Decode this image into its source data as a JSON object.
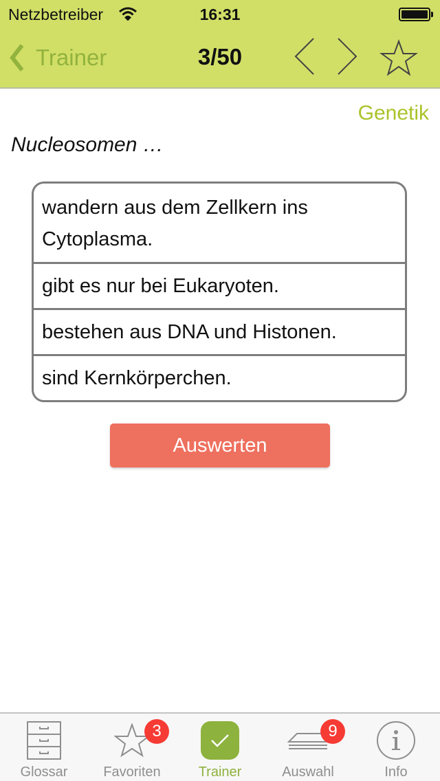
{
  "status_bar": {
    "carrier": "Netzbetreiber",
    "time": "16:31",
    "wifi_icon": "wifi-icon",
    "battery_icon": "battery-icon"
  },
  "nav": {
    "back_label": "Trainer",
    "back_icon": "chevron-left-icon",
    "title": "3/50",
    "prev_icon": "chevron-left-icon",
    "next_icon": "chevron-right-icon",
    "favorite_icon": "star-outline-icon"
  },
  "content": {
    "category": "Genetik",
    "question": "Nucleosomen …",
    "answers": [
      {
        "text": "wandern aus dem Zellkern ins Cytoplasma."
      },
      {
        "text": "gibt es nur bei Eukaryoten."
      },
      {
        "text": "bestehen aus DNA und Histonen."
      },
      {
        "text": "sind Kernkörperchen."
      }
    ],
    "evaluate_label": "Auswerten"
  },
  "tabbar": {
    "tabs": [
      {
        "label": "Glossar",
        "icon": "cabinet-icon",
        "active": false
      },
      {
        "label": "Favoriten",
        "icon": "star-icon",
        "badge": "3",
        "active": false
      },
      {
        "label": "Trainer",
        "icon": "checkmark-icon",
        "active": true
      },
      {
        "label": "Auswahl",
        "icon": "stack-icon",
        "badge": "9",
        "active": false
      },
      {
        "label": "Info",
        "icon": "info-icon",
        "active": false
      }
    ]
  },
  "colors": {
    "header_bg": "#d1df67",
    "accent_green": "#92b33d",
    "category_green": "#a9c32a",
    "evaluate_button": "#ee705e",
    "badge_red": "#f63b35",
    "active_tab": "#8db23d"
  }
}
